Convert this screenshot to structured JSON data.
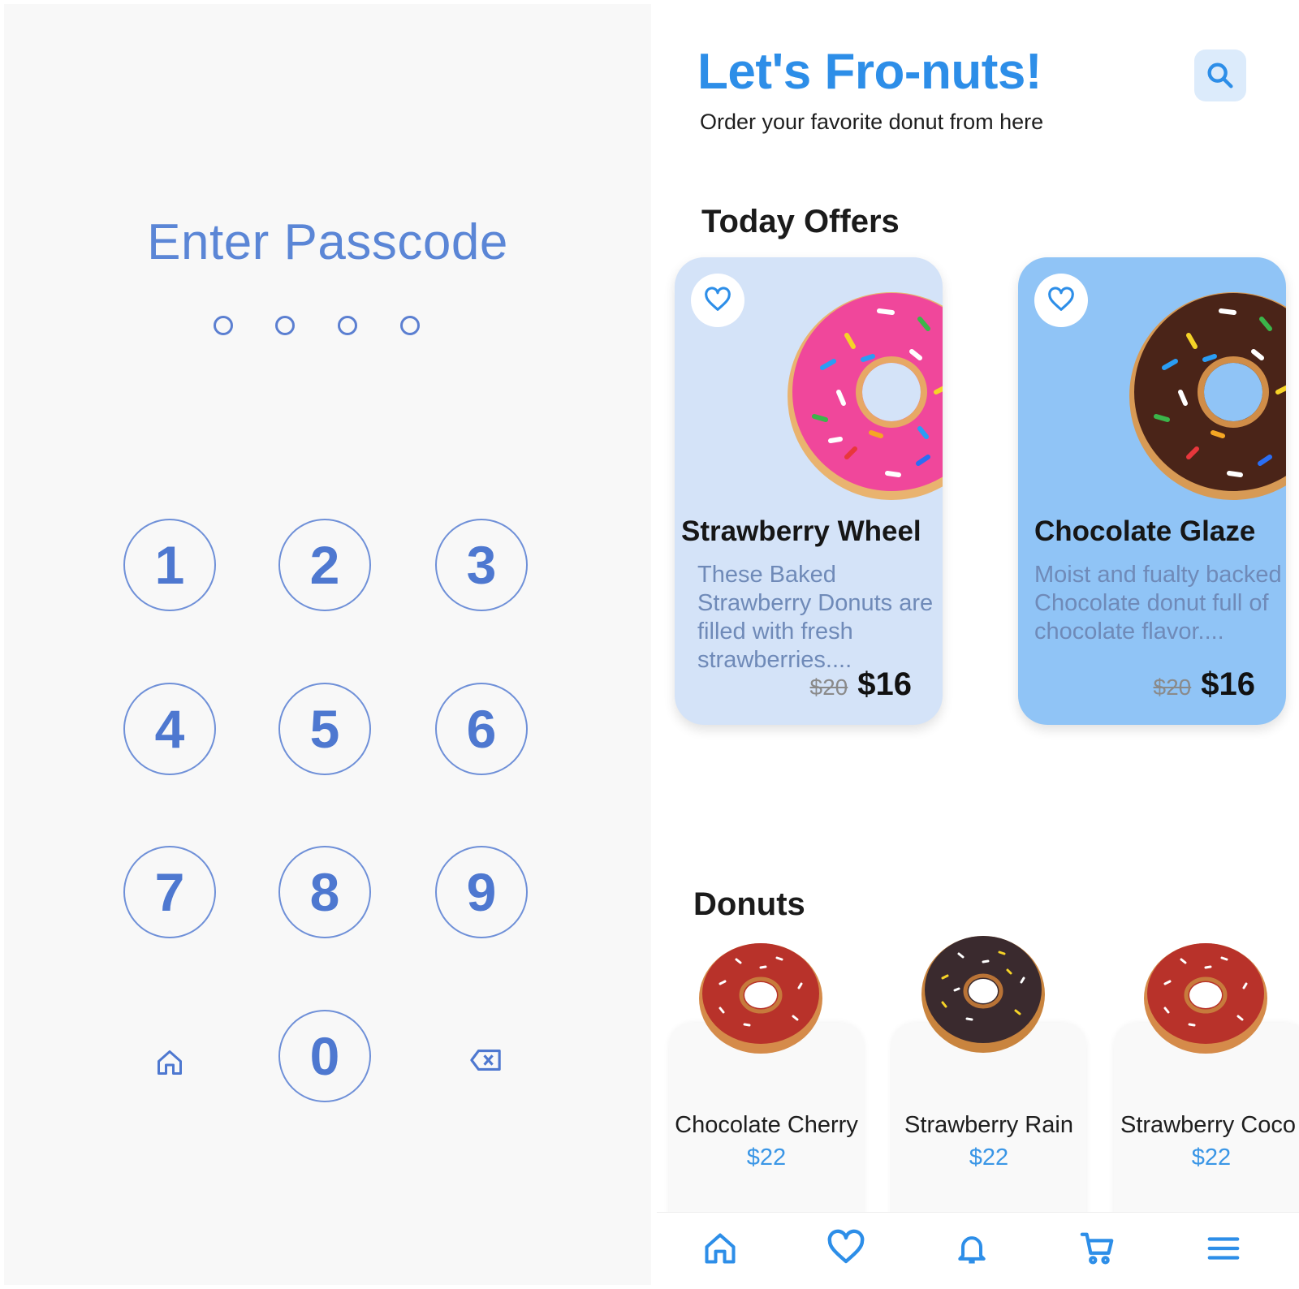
{
  "passcode": {
    "title": "Enter Passcode",
    "digits_entered": 0,
    "digits_total": 4,
    "keys": [
      "1",
      "2",
      "3",
      "4",
      "5",
      "6",
      "7",
      "8",
      "9",
      "0"
    ],
    "left_icon": "home-icon",
    "right_icon": "backspace-icon",
    "accent": "#4e78d0"
  },
  "shop": {
    "brand": "Let's Fro-nuts!",
    "subtitle": "Order your favorite donut from here",
    "search_icon": "search-icon",
    "offers_title": "Today Offers",
    "offers": [
      {
        "name": "Strawberry Wheel",
        "description": "These Baked Strawberry Donuts are filled with fresh strawberries....",
        "old_price": "$20",
        "price": "$16",
        "bg": "#d4e3f8",
        "glaze": "#f0479b"
      },
      {
        "name": "Chocolate Glaze",
        "description": "Moist and fualty backed Chocolate donut full of chocolate flavor....",
        "old_price": "$20",
        "price": "$16",
        "bg": "#90c4f6",
        "glaze": "#4a2418"
      }
    ],
    "donuts_title": "Donuts",
    "donuts": [
      {
        "name": "Chocolate Cherry",
        "price": "$22",
        "glaze": "#b8322a"
      },
      {
        "name": "Strawberry Rain",
        "price": "$22",
        "glaze": "#3a2a2e"
      },
      {
        "name": "Strawberry Coco",
        "price": "$22",
        "glaze": "#b8322a"
      }
    ],
    "nav": [
      "home-icon",
      "heart-icon",
      "bell-icon",
      "cart-icon",
      "menu-icon"
    ],
    "accent": "#2d8ee8"
  }
}
